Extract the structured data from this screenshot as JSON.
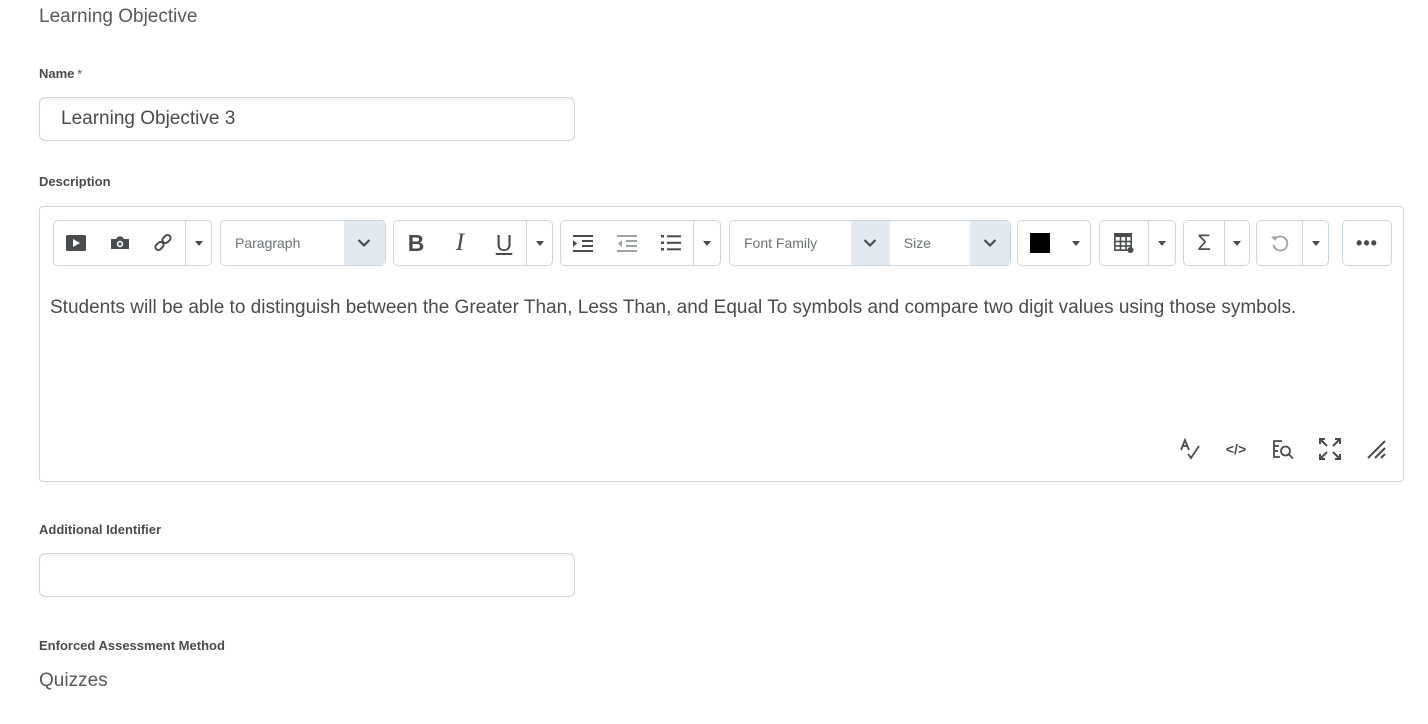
{
  "section": {
    "title": "Learning Objective"
  },
  "name_field": {
    "label": "Name",
    "required_marker": "*",
    "value": "Learning Objective 3"
  },
  "description": {
    "label": "Description",
    "toolbar": {
      "paragraph_label": "Paragraph",
      "font_family_label": "Font Family",
      "size_label": "Size",
      "text_color": "#000000"
    },
    "content": "Students will be able to distinguish between the Greater Than, Less Than, and Equal To symbols and compare two digit values using those symbols."
  },
  "additional_identifier": {
    "label": "Additional Identifier",
    "value": ""
  },
  "enforced_assessment": {
    "label": "Enforced Assessment Method",
    "value": "Quizzes"
  },
  "colors": {
    "text": "#494c4e",
    "border": "#cdd5dc",
    "dropdown_bg": "#e3e9f1"
  }
}
